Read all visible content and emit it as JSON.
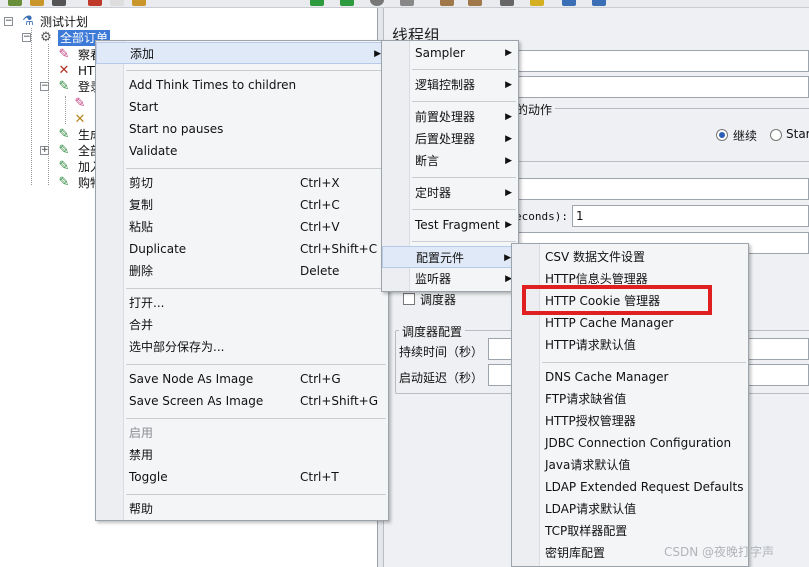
{
  "tree": {
    "root": {
      "label": "测试计划",
      "icon": "test-plan-icon"
    },
    "nodes": [
      {
        "label": "全部订单",
        "icon": "thread-group-gear-icon",
        "selected": true
      },
      {
        "label": "察看",
        "icon": "pipette-icon"
      },
      {
        "label": "HTT",
        "icon": "http-sampler-icon"
      },
      {
        "label": "登录",
        "icon": "pipette-icon"
      },
      {
        "label": "生成",
        "icon": "pipette-icon"
      },
      {
        "label": "全部",
        "icon": "pipette-icon"
      },
      {
        "label": "加入",
        "icon": "pipette-icon"
      },
      {
        "label": "购物",
        "icon": "pipette-icon"
      }
    ]
  },
  "right_panel": {
    "title": "线程组",
    "error_action_legend": "的动作",
    "radio_continue": "继续",
    "radio_start": "Star",
    "ramp_label": "econds):",
    "ramp_value": "1",
    "scheduler_checkbox_label": "调度器",
    "scheduler_group_legend": "调度器配置",
    "duration_label": "持续时间（秒）",
    "startup_delay_label": "启动延迟（秒）"
  },
  "context_menu": {
    "items": [
      {
        "label": "添加",
        "shortcut": "",
        "submenu": true,
        "highlight": true
      },
      {
        "label": "Add Think Times to children",
        "shortcut": ""
      },
      {
        "label": "Start",
        "shortcut": ""
      },
      {
        "label": "Start no pauses",
        "shortcut": ""
      },
      {
        "label": "Validate",
        "shortcut": ""
      },
      {
        "label": "剪切",
        "shortcut": "Ctrl+X"
      },
      {
        "label": "复制",
        "shortcut": "Ctrl+C"
      },
      {
        "label": "粘贴",
        "shortcut": "Ctrl+V"
      },
      {
        "label": "Duplicate",
        "shortcut": "Ctrl+Shift+C"
      },
      {
        "label": "删除",
        "shortcut": "Delete"
      },
      {
        "label": "打开...",
        "shortcut": ""
      },
      {
        "label": "合并",
        "shortcut": ""
      },
      {
        "label": "选中部分保存为...",
        "shortcut": ""
      },
      {
        "label": "Save Node As Image",
        "shortcut": "Ctrl+G"
      },
      {
        "label": "Save Screen As Image",
        "shortcut": "Ctrl+Shift+G"
      },
      {
        "label": "启用",
        "shortcut": "",
        "disabled": true
      },
      {
        "label": "禁用",
        "shortcut": ""
      },
      {
        "label": "Toggle",
        "shortcut": "Ctrl+T"
      },
      {
        "label": "帮助",
        "shortcut": ""
      }
    ]
  },
  "add_submenu": {
    "items": [
      {
        "label": "Sampler",
        "submenu": true
      },
      {
        "label": "逻辑控制器",
        "submenu": true
      },
      {
        "label": "前置处理器",
        "submenu": true
      },
      {
        "label": "后置处理器",
        "submenu": true
      },
      {
        "label": "断言",
        "submenu": true
      },
      {
        "label": "定时器",
        "submenu": true
      },
      {
        "label": "Test Fragment",
        "submenu": true
      },
      {
        "label": "配置元件",
        "submenu": true,
        "highlight": true
      },
      {
        "label": "监听器",
        "submenu": true
      }
    ]
  },
  "config_submenu": {
    "items": [
      {
        "label": "CSV 数据文件设置"
      },
      {
        "label": "HTTP信息头管理器"
      },
      {
        "label": "HTTP Cookie 管理器",
        "boxed": true
      },
      {
        "label": "HTTP Cache Manager"
      },
      {
        "label": "HTTP请求默认值"
      },
      {
        "label": "DNS Cache Manager"
      },
      {
        "label": "FTP请求缺省值"
      },
      {
        "label": "HTTP授权管理器"
      },
      {
        "label": "JDBC Connection Configuration"
      },
      {
        "label": "Java请求默认值"
      },
      {
        "label": "LDAP Extended Request Defaults"
      },
      {
        "label": "LDAP请求默认值"
      },
      {
        "label": "TCP取样器配置"
      },
      {
        "label": "密钥库配置"
      }
    ]
  },
  "watermark": "CSDN @夜晚打字声",
  "colors": {
    "selection": "#3d79d6",
    "menu_highlight": "#dfe9f7",
    "annotation_box": "#e02020"
  }
}
